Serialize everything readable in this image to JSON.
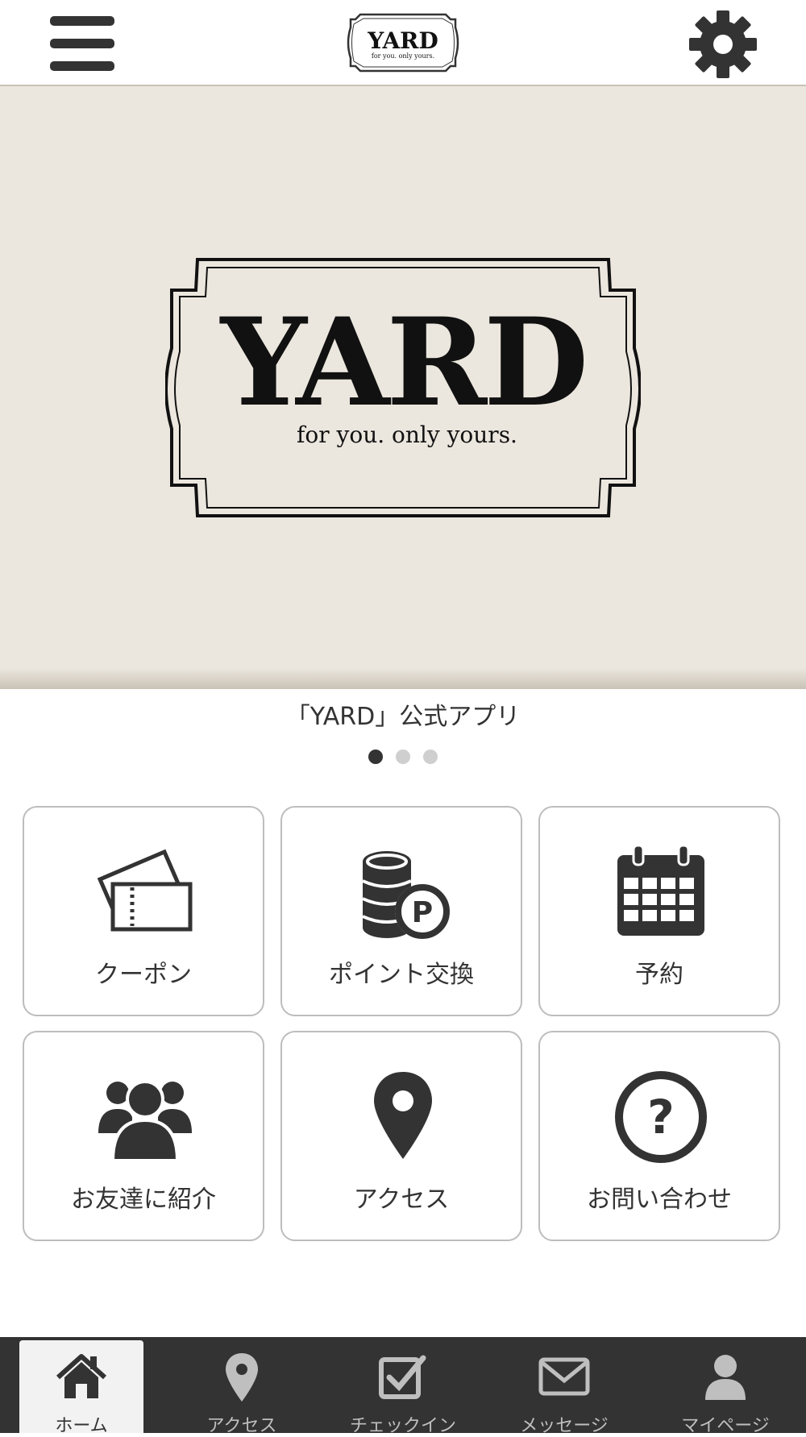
{
  "header": {
    "menu_icon": "hamburger-icon",
    "settings_icon": "gear-icon",
    "logo_text": "YARD",
    "logo_tagline": "for you. only yours."
  },
  "hero": {
    "logo_text": "YARD",
    "logo_tagline": "for you. only yours."
  },
  "carousel": {
    "caption": "「YARD」公式アプリ",
    "page_count": 3,
    "active_index": 0
  },
  "menu_tiles": [
    {
      "label": "クーポン",
      "icon": "ticket-icon"
    },
    {
      "label": "ポイント交換",
      "icon": "coins-point-icon"
    },
    {
      "label": "予約",
      "icon": "calendar-icon"
    },
    {
      "label": "お友達に紹介",
      "icon": "users-group-icon"
    },
    {
      "label": "アクセス",
      "icon": "map-pin-icon"
    },
    {
      "label": "お問い合わせ",
      "icon": "question-circle-icon"
    }
  ],
  "tabbar": {
    "tabs": [
      {
        "label": "ホーム",
        "icon": "home-icon",
        "active": true
      },
      {
        "label": "アクセス",
        "icon": "map-pin-icon",
        "active": false
      },
      {
        "label": "チェックイン",
        "icon": "checkin-icon",
        "active": false
      },
      {
        "label": "メッセージ",
        "icon": "envelope-icon",
        "active": false
      },
      {
        "label": "マイページ",
        "icon": "person-icon",
        "active": false
      }
    ]
  },
  "colors": {
    "header_bg": "#ffffff",
    "hero_bg": "#ece7de",
    "icon_dark": "#333333",
    "tabbar_bg": "#333333",
    "tile_border": "#bdbdbd",
    "dot_active": "#333333",
    "dot_inactive": "#cfcfcf"
  }
}
